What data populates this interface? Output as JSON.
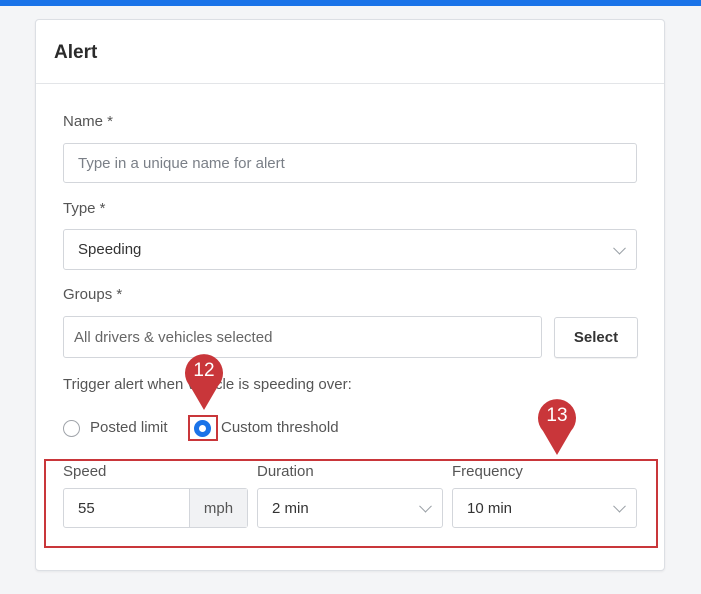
{
  "card": {
    "title": "Alert"
  },
  "form": {
    "name": {
      "label": "Name *",
      "placeholder": "Type in a unique name for alert"
    },
    "type": {
      "label": "Type *",
      "value": "Speeding"
    },
    "groups": {
      "label": "Groups *",
      "placeholder": "All drivers & vehicles selected",
      "button": "Select"
    },
    "trigger": {
      "label": "Trigger alert when vehicle is speeding over:",
      "options": [
        {
          "label": "Posted limit",
          "selected": false
        },
        {
          "label": "Custom threshold",
          "selected": true
        }
      ]
    },
    "speed": {
      "label": "Speed",
      "value": "55",
      "unit": "mph"
    },
    "duration": {
      "label": "Duration",
      "value": "2 min"
    },
    "frequency": {
      "label": "Frequency",
      "value": "10 min"
    }
  },
  "annotations": [
    {
      "number": "12",
      "target": "custom-threshold-radio"
    },
    {
      "number": "13",
      "target": "threshold-fields"
    }
  ],
  "colors": {
    "accent": "#1a73e8",
    "annotation": "#c9363a"
  }
}
